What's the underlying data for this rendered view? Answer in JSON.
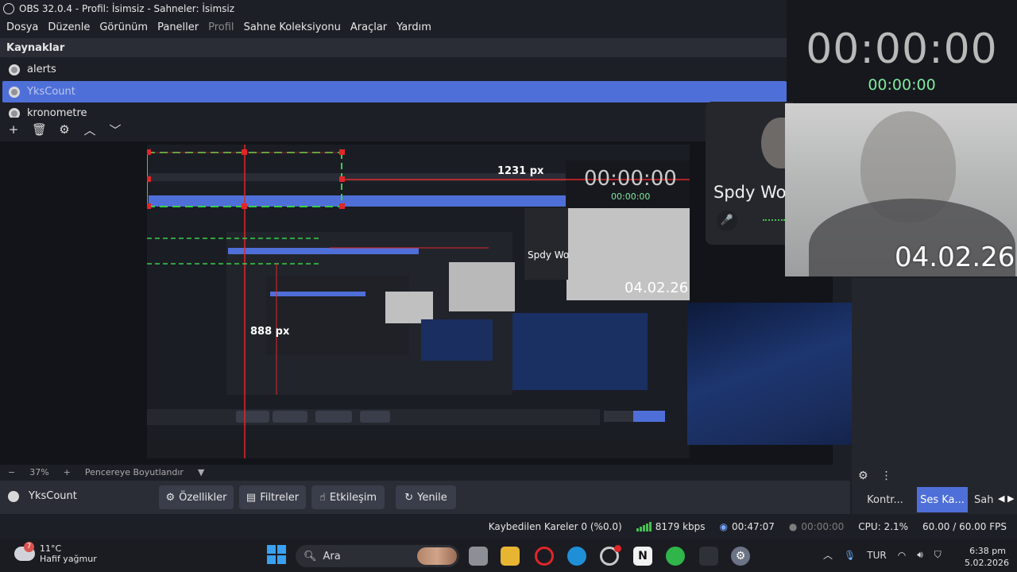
{
  "window": {
    "title": "OBS 32.0.4 - Profil: İsimsiz - Sahneler: İsimsiz"
  },
  "menu": [
    "Dosya",
    "Düzenle",
    "Görünüm",
    "Paneller",
    "Profil",
    "Sahne Koleksiyonu",
    "Araçlar",
    "Yardım"
  ],
  "sources": {
    "header": "Kaynaklar",
    "items": [
      {
        "label": "alerts",
        "selected": false
      },
      {
        "label": "YksCount",
        "selected": true
      },
      {
        "label": "kronometre",
        "selected": false
      }
    ]
  },
  "overlay": {
    "timer_main": "00:00:00",
    "timer_sub": "00:00:00",
    "discord_name": "Spdy Wo",
    "webcam_date": "04.02.26"
  },
  "nested_capture": {
    "measure_h": "1231 px",
    "measure_v": "888 px",
    "timer": "00:00:00",
    "timer_sub": "00:00:00",
    "name": "Spdy Wo",
    "date": "04.02.26"
  },
  "zoom": {
    "percent": "37%",
    "fit_label": "Pencereye Boyutlandır"
  },
  "properties": {
    "source_name": "YksCount",
    "buttons": [
      "Özellikler",
      "Filtreler",
      "Etkileşim",
      "Yenile"
    ]
  },
  "right_dock": {
    "tabs": [
      "Kontr...",
      "Ses Ka...",
      "Sah"
    ]
  },
  "status": {
    "dropped_frames": "Kaybedilen Kareler 0 (%0.0)",
    "bitrate": "8179 kbps",
    "rec_time": "00:47:07",
    "stream_time": "00:00:00",
    "cpu": "CPU: 2.1%",
    "fps": "60.00 / 60.00 FPS"
  },
  "taskbar": {
    "weather_temp": "11°C",
    "weather_desc": "Hafif yağmur",
    "weather_badge": "7",
    "search_placeholder": "Ara",
    "lang": "TUR",
    "time": "6:38 pm",
    "date": "5.02.2026"
  },
  "colors": {
    "accent": "#4f6fd8",
    "timer_green": "#7fe9a0",
    "bitrate_green": "#44c04f"
  }
}
